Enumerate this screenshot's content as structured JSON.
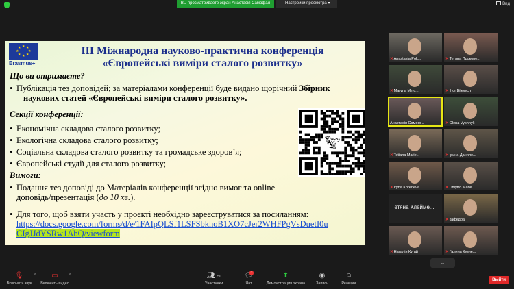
{
  "topbar": {
    "share_banner": "Вы просматриваете экран Анастасія Самофал",
    "view_settings": "Настройки просмотра",
    "view_label": "Вид"
  },
  "slide": {
    "logo_text": "Erasmus+",
    "title_line1": "ІІІ Міжнародна науково-практична конференція",
    "title_line2": "«Європейські виміри сталого розвитку»",
    "section1": "Що ви отримаєте?",
    "bullet1_text": "Публікація тез доповідей; за матеріалами конференції буде видано щорічний",
    "bullet1_bold": "Збірник",
    "bullet1_bold2": "наукових статей «Європейські виміри сталого розвитку».",
    "section2": "Секції конференції:",
    "sections": [
      "Економічна складова сталого розвитку;",
      "Екологічна складова сталого розвитку;",
      "Соціальна складова сталого розвитку та громадське здоров’я;",
      "Європейські студії для сталого розвитку;"
    ],
    "section3": "Вимоги:",
    "req1_line1": "Подання  тез  доповіді  до  Матеріалів  конференції  згідно  вимог  та  online",
    "req1_line2": "доповідь/презентація (",
    "req1_italic": "до 10 хв.",
    "req1_end": ").",
    "req2_line1": "Для того, щоб взяти участь у проєкті необхідно зареєструватися за",
    "req2_link_word": "посиланням",
    "req2_colon": ":",
    "link_line1": "https://docs.google.com/forms/d/e/1FAIpQLSf1LSFSbkhoB1XO7cJer2WHFPgVsDuetI0u",
    "link_line2": "CIgJJdYSRw1AbQ/viewform"
  },
  "participants": [
    {
      "name": "Anastasia Pok...",
      "muted": true
    },
    {
      "name": "Тетяна Прокопе...",
      "muted": true
    },
    {
      "name": "Maryna Minc...",
      "muted": true
    },
    {
      "name": "Ihor Bilevych",
      "muted": true
    },
    {
      "name": "Анастасія Самоф...",
      "muted": false
    },
    {
      "name": "Olena Vyshnyk",
      "muted": true
    },
    {
      "name": "Tetiana Marie...",
      "muted": true
    },
    {
      "name": "Ірина  Даниле...",
      "muted": true
    },
    {
      "name": "Iryna Koreneva",
      "muted": true
    },
    {
      "name": "Dmytro Marie...",
      "muted": true
    },
    {
      "name": "Тетяна  Клейме...",
      "muted": false
    },
    {
      "name": "кафедра",
      "muted": true
    },
    {
      "name": "Наталія Кугай",
      "muted": true
    },
    {
      "name": "Галина Кузне...",
      "muted": true
    }
  ],
  "toolbar": {
    "audio": "Включить звук",
    "video": "Включить видео",
    "participants": "Участники",
    "participants_count": "50",
    "chat": "Чат",
    "chat_badge": "3",
    "share": "Демонстрация экрана",
    "record": "Запись",
    "reactions": "Реакции",
    "exit": "Выйти"
  },
  "colors": {
    "title_blue": "#1c2f8c",
    "link_blue": "#1a4fd0",
    "share_green": "#1f9e31",
    "exit_red": "#e02828",
    "active_speaker": "#e6e614"
  }
}
